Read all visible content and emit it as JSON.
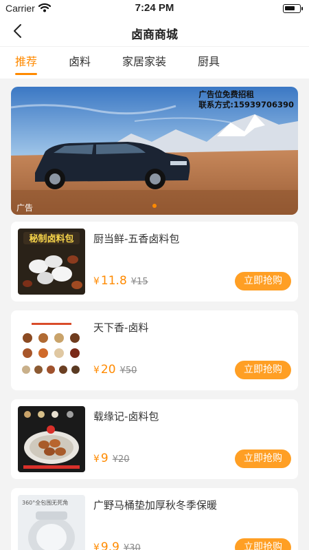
{
  "status": {
    "carrier": "Carrier",
    "time": "7:24 PM"
  },
  "nav": {
    "title": "卤商商城"
  },
  "tabs": [
    {
      "label": "推荐",
      "active": true
    },
    {
      "label": "卤料",
      "active": false
    },
    {
      "label": "家居家装",
      "active": false
    },
    {
      "label": "厨具",
      "active": false
    }
  ],
  "banner": {
    "line1": "广告位免费招租",
    "line2": "联系方式:15939706390",
    "tag": "广告"
  },
  "products": [
    {
      "name": "厨当鲜-五香卤料包",
      "price": "11.8",
      "original": "¥15",
      "button": "立即抢购",
      "thumb_text": "秘制卤料包"
    },
    {
      "name": "天下香-卤料",
      "price": "20",
      "original": "¥50",
      "button": "立即抢购"
    },
    {
      "name": "载缘记-卤料包",
      "price": "9",
      "original": "¥20",
      "button": "立即抢购"
    },
    {
      "name": "广野马桶垫加厚秋冬季保暖",
      "price": "9.9",
      "original": "¥30",
      "button": "立即抢购",
      "thumb_text": "360°全包围无死角"
    }
  ],
  "currency": "¥",
  "colors": {
    "accent": "#ff8a00",
    "button": "#ff9f24"
  }
}
